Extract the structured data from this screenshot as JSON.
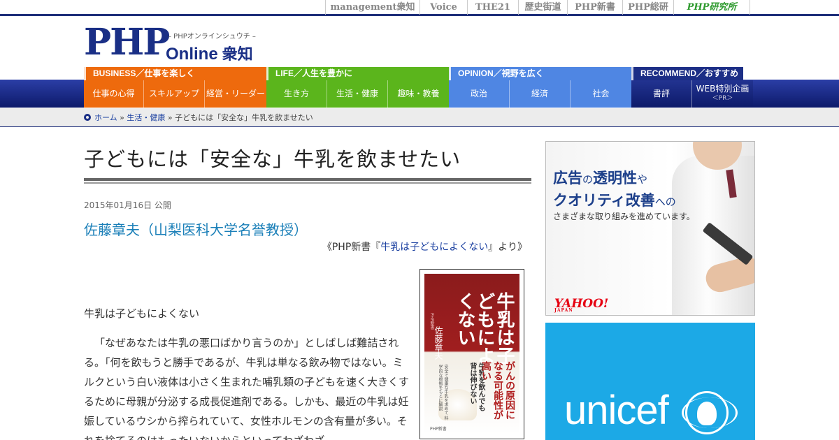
{
  "network_links": [
    {
      "label": "management衆知",
      "width": 135
    },
    {
      "label": "Voice",
      "width": 68
    },
    {
      "label": "THE21",
      "width": 73
    },
    {
      "label": "歴史街道",
      "width": 70
    },
    {
      "label": "PHP新書",
      "width": 79
    },
    {
      "label": "PHP総研",
      "width": 73
    },
    {
      "label": "PHP研究所",
      "width": 110
    }
  ],
  "logo": {
    "php": "PHP",
    "tagline": "– PHPオンラインシュウチ –",
    "online": "Online",
    "shuchi": "衆知"
  },
  "nav": {
    "business": {
      "head": "BUSINESS／仕事を楽しく",
      "items": [
        "仕事の心得",
        "スキルアップ",
        "経営・リーダー"
      ]
    },
    "life": {
      "head": "LIFE／人生を豊かに",
      "items": [
        "生き方",
        "生活・健康",
        "趣味・教養"
      ]
    },
    "opinion": {
      "head": "OPINION／視野を広く",
      "items": [
        "政治",
        "経済",
        "社会"
      ]
    },
    "recommend": {
      "head": "RECOMMEND／おすすめ",
      "items": [
        "書評",
        "WEB特別企画"
      ],
      "pr": "＜PR＞"
    }
  },
  "breadcrumb": {
    "home": "ホーム",
    "sep1": " » ",
    "category": "生活・健康",
    "sep2": " » ",
    "current": "子どもには「安全な」牛乳を飲ませたい"
  },
  "article": {
    "title": "子どもには「安全な」牛乳を飲ませたい",
    "date": "2015年01月16日 公開",
    "author": "佐藤章夫（山梨医科大学名誉教授）",
    "source_prefix": "《PHP新書『",
    "source_link": "牛乳は子どもによくない",
    "source_suffix": "』より》",
    "lead": "牛乳は子どもによくない",
    "paragraph": "「なぜあなたは牛乳の悪口ばかり言うのか」としばしば難詰される。「何を飲もうと勝手であるが、牛乳は単なる飲み物ではない。ミルクという白い液体は小さく生まれた哺乳類の子どもを速く大きくするために母親が分泌する成長促進剤である。しかも、最近の牛乳は妊娠しているウシから搾られていて、女性ホルモンの含有量が多い。それを捨てるのはもったいないからといってわざわざ"
  },
  "book": {
    "title": "牛乳は子どもによくない",
    "author": "佐藤章夫",
    "label": "PHP新書",
    "tag1": "がんの原因になる可能性が高い",
    "tag2": "牛乳を飲んでも背は伸びない",
    "fine": "安全で健康な牛乳を求めて 科学的な根拠をもとに解説",
    "publisher": "PHP新書"
  },
  "ad_yahoo": {
    "line1_a": "広告",
    "line1_b": "の",
    "line1_c": "透明性",
    "line1_d": "や",
    "line2_a": "クオリティ改善",
    "line2_b": "への",
    "line3": "さまざまな取り組みを進めています。",
    "logo": "YAHOO!",
    "logo_sub": "JAPAN"
  },
  "ad_unicef": {
    "text": "unicef"
  }
}
